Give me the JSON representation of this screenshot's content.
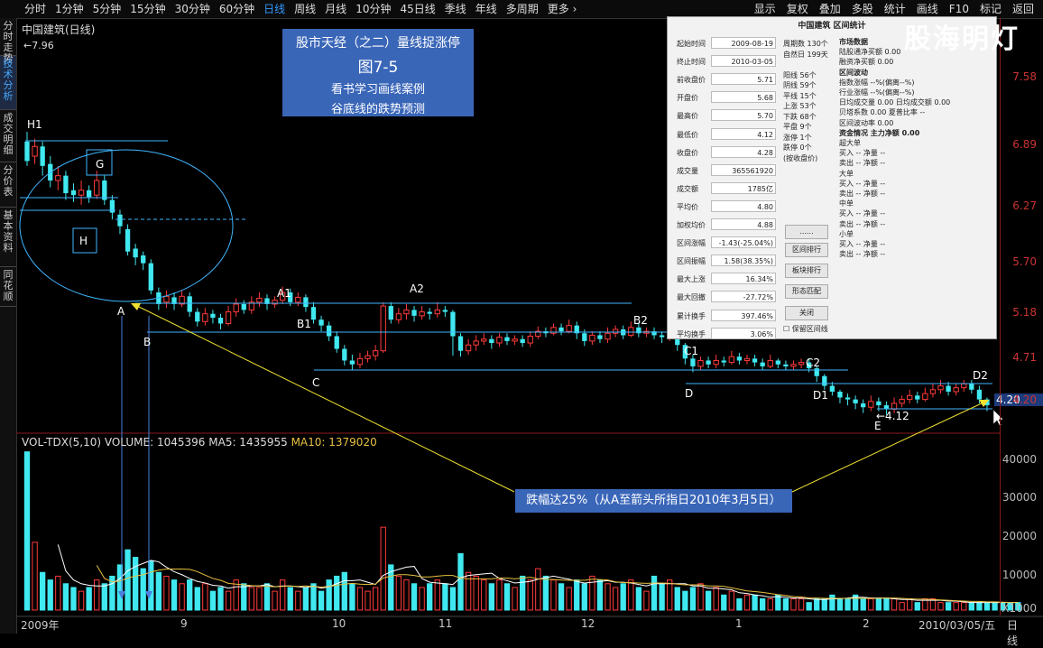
{
  "topbar": {
    "tabs": [
      "分时",
      "1分钟",
      "5分钟",
      "15分钟",
      "30分钟",
      "60分钟",
      "日线",
      "周线",
      "月线",
      "10分钟",
      "45日线",
      "季线",
      "年线",
      "多周期",
      "更多 ›"
    ],
    "active_tab": "日线",
    "right": [
      "显示",
      "复权",
      "叠加",
      "多股",
      "统计",
      "画线",
      "F10",
      "标记",
      "返回"
    ]
  },
  "sidebar": [
    "分时走势",
    "技术分析",
    "成交明细",
    "分价表",
    "基本资料",
    "同花顺"
  ],
  "stock": {
    "name": "中国建筑(日线)",
    "high_label": "7.96"
  },
  "price_axis": [
    "7.58",
    "6.89",
    "6.27",
    "5.70",
    "5.18",
    "4.71",
    "4.20"
  ],
  "current_price": "4.20",
  "vol_axis": [
    "40000",
    "30000",
    "20000",
    "10000",
    "X1000"
  ],
  "date_axis": [
    "2009年",
    "9",
    "10",
    "11",
    "12",
    "1",
    "2",
    "2010/03/05/五",
    "日线"
  ],
  "title_box": {
    "line1": "股市天经（之二）量线捉涨停",
    "line2": "图7-5",
    "line3": "看书学习画线案例",
    "line4": "谷底线的跌势预测"
  },
  "note": "跌幅达25%（从A至箭头所指日2010年3月5日）",
  "vol_legend": {
    "name": "VOL-TDX(5,10)",
    "volume": "VOLUME: 1045396",
    "ma5": "MA5: 1435955",
    "ma10": "MA10: 1379020"
  },
  "points": {
    "H1": "H1",
    "G": "G",
    "H": "H",
    "A": "A",
    "B": "B",
    "A1": "A1",
    "B1": "B1",
    "C": "C",
    "A2": "A2",
    "B2": "B2",
    "C1": "C1",
    "D": "D",
    "C2": "C2",
    "D1": "D1",
    "D2": "D2",
    "E": "E",
    "low": "←4.12"
  },
  "watermark": "股海明灯",
  "panel": {
    "title": "中国建筑 区间统计",
    "rows": [
      [
        "起始时间",
        "2009-08-19"
      ],
      [
        "终止时间",
        "2010-03-05"
      ],
      [
        "前收盘价",
        "5.71"
      ],
      [
        "开盘价",
        "5.68"
      ],
      [
        "最高价",
        "5.70"
      ],
      [
        "最低价",
        "4.12"
      ],
      [
        "收盘价",
        "4.28"
      ],
      [
        "成交量",
        "365561920"
      ],
      [
        "成交额",
        "1785亿"
      ],
      [
        "平均价",
        "4.80"
      ],
      [
        "加权均价",
        "4.88"
      ],
      [
        "区间涨幅",
        "-1.43(-25.04%)"
      ],
      [
        "区间振幅",
        "1.58(38.35%)"
      ],
      [
        "最大上涨",
        "16.34%"
      ],
      [
        "最大回撤",
        "-27.72%"
      ],
      [
        "累计换手",
        "397.46%"
      ],
      [
        "平均换手",
        "3.06%"
      ]
    ],
    "stats": [
      "周期数 130个",
      "自然日 199天",
      "",
      "阳线 56个",
      "阴线 59个",
      "平线 15个",
      "上涨 53个",
      "下跌 68个",
      "平盘 9个",
      "涨停 1个",
      "跌停 0个",
      "(按收盘价)"
    ],
    "buttons": [
      "......",
      "区间排行",
      "板块排行",
      "形态匹配",
      "关闭"
    ],
    "checkbox": "保留区间线",
    "market": [
      {
        "t": "市场数据",
        "h": true
      },
      {
        "t": "陆股通净买额 0.00"
      },
      {
        "t": "融资净买额 0.00"
      },
      {
        "t": "区间波动",
        "h": true
      },
      {
        "t": "指数涨幅 --%(偏离--%)"
      },
      {
        "t": "行业涨幅 --%(偏离--%)"
      },
      {
        "t": "日均成交量 0.00   日均成交额 0.00"
      },
      {
        "t": "贝塔系数 0.00    夏普比率 --"
      },
      {
        "t": "区间波动率 0.00"
      },
      {
        "t": "资金情况  主力净额 0.00",
        "h": true
      },
      {
        "t": "超大单"
      },
      {
        "t": "买入 --      净量 --"
      },
      {
        "t": "卖出 --      净额 --"
      },
      {
        "t": "大单"
      },
      {
        "t": "买入 --      净量 --"
      },
      {
        "t": "卖出 --      净额 --"
      },
      {
        "t": "中单"
      },
      {
        "t": "买入 --      净量 --"
      },
      {
        "t": "卖出 --      净额 --"
      },
      {
        "t": "小单"
      },
      {
        "t": "买入 --      净量 --"
      },
      {
        "t": "卖出 --      净额 --"
      }
    ]
  },
  "colors": {
    "up": "#ff3b3b",
    "down": "#40e8f0",
    "ma5": "#ffffff",
    "ma10": "#e8c040",
    "line": "#3fb6ff",
    "arrow": "#f0e030",
    "axis": "#8b1a1a"
  },
  "candles": [
    [
      6.95,
      6.75,
      7.05,
      6.7
    ],
    [
      6.8,
      6.9,
      6.98,
      6.72
    ],
    [
      6.9,
      6.7,
      6.95,
      6.6
    ],
    [
      6.72,
      6.55,
      6.8,
      6.48
    ],
    [
      6.55,
      6.6,
      6.7,
      6.45
    ],
    [
      6.6,
      6.42,
      6.65,
      6.35
    ],
    [
      6.45,
      6.4,
      6.52,
      6.33
    ],
    [
      6.4,
      6.45,
      6.55,
      6.3
    ],
    [
      6.45,
      6.38,
      6.5,
      6.32
    ],
    [
      6.4,
      6.55,
      6.65,
      6.36
    ],
    [
      6.55,
      6.35,
      6.6,
      6.3
    ],
    [
      6.35,
      6.22,
      6.4,
      6.15
    ],
    [
      6.2,
      6.08,
      6.25,
      6.0
    ],
    [
      6.05,
      5.82,
      6.1,
      5.78
    ],
    [
      5.85,
      5.76,
      5.9,
      5.68
    ],
    [
      5.78,
      5.7,
      5.82,
      5.63
    ],
    [
      5.7,
      5.42,
      5.74,
      5.38
    ],
    [
      5.4,
      5.28,
      5.45,
      5.22
    ],
    [
      5.3,
      5.36,
      5.42,
      5.24
    ],
    [
      5.35,
      5.28,
      5.4,
      5.22
    ],
    [
      5.28,
      5.36,
      5.42,
      5.25
    ],
    [
      5.36,
      5.2,
      5.4,
      5.15
    ],
    [
      5.2,
      5.1,
      5.24,
      5.05
    ],
    [
      5.1,
      5.18,
      5.24,
      5.06
    ],
    [
      5.18,
      5.14,
      5.22,
      5.08
    ],
    [
      5.14,
      5.08,
      5.18,
      5.02
    ],
    [
      5.08,
      5.2,
      5.26,
      5.06
    ],
    [
      5.2,
      5.28,
      5.34,
      5.15
    ],
    [
      5.28,
      5.22,
      5.32,
      5.18
    ],
    [
      5.22,
      5.3,
      5.36,
      5.18
    ],
    [
      5.3,
      5.34,
      5.4,
      5.25
    ],
    [
      5.34,
      5.28,
      5.38,
      5.22
    ],
    [
      5.28,
      5.32,
      5.36,
      5.24
    ],
    [
      5.32,
      5.4,
      5.46,
      5.28
    ],
    [
      5.4,
      5.3,
      5.44,
      5.26
    ],
    [
      5.3,
      5.35,
      5.4,
      5.26
    ],
    [
      5.35,
      5.25,
      5.38,
      5.2
    ],
    [
      5.25,
      5.12,
      5.3,
      5.08
    ],
    [
      5.12,
      5.06,
      5.16,
      5.0
    ],
    [
      5.06,
      4.95,
      5.1,
      4.9
    ],
    [
      4.95,
      4.82,
      5.0,
      4.78
    ],
    [
      4.82,
      4.7,
      4.86,
      4.65
    ],
    [
      4.7,
      4.66,
      4.76,
      4.6
    ],
    [
      4.66,
      4.72,
      4.78,
      4.62
    ],
    [
      4.72,
      4.75,
      4.8,
      4.68
    ],
    [
      4.75,
      4.8,
      4.86,
      4.7
    ],
    [
      4.8,
      5.26,
      5.3,
      4.78
    ],
    [
      5.26,
      5.12,
      5.3,
      5.08
    ],
    [
      5.12,
      5.18,
      5.24,
      5.08
    ],
    [
      5.18,
      5.22,
      5.28,
      5.12
    ],
    [
      5.22,
      5.16,
      5.26,
      5.1
    ],
    [
      5.16,
      5.2,
      5.26,
      5.12
    ],
    [
      5.2,
      5.18,
      5.24,
      5.12
    ],
    [
      5.18,
      5.22,
      5.3,
      5.14
    ],
    [
      5.22,
      5.2,
      5.26,
      5.15
    ],
    [
      5.2,
      4.95,
      5.22,
      4.75
    ],
    [
      4.95,
      4.8,
      4.98,
      4.74
    ],
    [
      4.8,
      4.86,
      4.92,
      4.76
    ],
    [
      4.86,
      4.9,
      4.96,
      4.8
    ],
    [
      4.9,
      4.92,
      4.98,
      4.86
    ],
    [
      4.92,
      4.88,
      4.96,
      4.82
    ],
    [
      4.88,
      4.94,
      4.98,
      4.84
    ],
    [
      4.94,
      4.9,
      4.98,
      4.86
    ],
    [
      4.9,
      4.92,
      4.96,
      4.86
    ],
    [
      4.92,
      4.88,
      4.96,
      4.84
    ],
    [
      4.88,
      4.95,
      5.0,
      4.84
    ],
    [
      4.95,
      5.0,
      5.05,
      4.92
    ],
    [
      5.0,
      4.98,
      5.04,
      4.94
    ],
    [
      4.98,
      5.04,
      5.08,
      4.96
    ],
    [
      5.04,
      5.0,
      5.08,
      4.96
    ],
    [
      5.0,
      5.06,
      5.12,
      4.98
    ],
    [
      5.06,
      4.98,
      5.1,
      4.92
    ],
    [
      4.98,
      4.9,
      5.02,
      4.85
    ],
    [
      4.9,
      4.96,
      5.0,
      4.86
    ],
    [
      4.96,
      4.92,
      5.0,
      4.88
    ],
    [
      4.92,
      4.98,
      5.04,
      4.88
    ],
    [
      4.98,
      5.02,
      5.06,
      4.94
    ],
    [
      5.02,
      4.96,
      5.06,
      4.92
    ],
    [
      4.96,
      5.04,
      5.1,
      4.94
    ],
    [
      5.04,
      4.98,
      5.08,
      4.94
    ],
    [
      4.98,
      5.0,
      5.04,
      4.94
    ],
    [
      5.0,
      4.96,
      5.04,
      4.92
    ],
    [
      4.96,
      4.94,
      5.0,
      4.88
    ],
    [
      4.94,
      4.98,
      5.02,
      4.9
    ],
    [
      4.98,
      4.86,
      5.0,
      4.8
    ],
    [
      4.86,
      4.72,
      4.88,
      4.66
    ],
    [
      4.72,
      4.64,
      4.76,
      4.58
    ],
    [
      4.64,
      4.7,
      4.74,
      4.6
    ],
    [
      4.7,
      4.66,
      4.74,
      4.62
    ],
    [
      4.66,
      4.7,
      4.76,
      4.62
    ],
    [
      4.7,
      4.68,
      4.74,
      4.64
    ],
    [
      4.68,
      4.74,
      4.8,
      4.66
    ],
    [
      4.74,
      4.7,
      4.78,
      4.66
    ],
    [
      4.7,
      4.72,
      4.76,
      4.66
    ],
    [
      4.72,
      4.68,
      4.76,
      4.64
    ],
    [
      4.68,
      4.64,
      4.72,
      4.6
    ],
    [
      4.64,
      4.7,
      4.76,
      4.62
    ],
    [
      4.7,
      4.66,
      4.72,
      4.62
    ],
    [
      4.66,
      4.64,
      4.7,
      4.6
    ],
    [
      4.64,
      4.66,
      4.7,
      4.6
    ],
    [
      4.66,
      4.68,
      4.72,
      4.62
    ],
    [
      4.68,
      4.62,
      4.72,
      4.58
    ],
    [
      4.62,
      4.54,
      4.64,
      4.48
    ],
    [
      4.54,
      4.44,
      4.56,
      4.4
    ],
    [
      4.44,
      4.38,
      4.48,
      4.34
    ],
    [
      4.38,
      4.32,
      4.4,
      4.26
    ],
    [
      4.32,
      4.3,
      4.36,
      4.24
    ],
    [
      4.3,
      4.26,
      4.34,
      4.2
    ],
    [
      4.26,
      4.22,
      4.3,
      4.16
    ],
    [
      4.22,
      4.28,
      4.34,
      4.18
    ],
    [
      4.28,
      4.24,
      4.32,
      4.18
    ],
    [
      4.24,
      4.2,
      4.28,
      4.14
    ],
    [
      4.2,
      4.26,
      4.32,
      4.16
    ],
    [
      4.26,
      4.3,
      4.34,
      4.22
    ],
    [
      4.3,
      4.34,
      4.4,
      4.26
    ],
    [
      4.34,
      4.3,
      4.38,
      4.26
    ],
    [
      4.3,
      4.36,
      4.42,
      4.28
    ],
    [
      4.36,
      4.4,
      4.46,
      4.32
    ],
    [
      4.4,
      4.44,
      4.5,
      4.36
    ],
    [
      4.44,
      4.38,
      4.48,
      4.34
    ],
    [
      4.38,
      4.42,
      4.46,
      4.34
    ],
    [
      4.42,
      4.46,
      4.5,
      4.38
    ],
    [
      4.46,
      4.4,
      4.5,
      4.36
    ],
    [
      4.4,
      4.3,
      4.44,
      4.26
    ],
    [
      4.3,
      4.24,
      4.32,
      4.18
    ]
  ],
  "volumes": [
    42,
    18,
    10,
    8,
    9,
    7,
    6,
    5,
    6,
    8,
    7,
    9,
    12,
    16,
    14,
    11,
    13,
    10,
    9,
    8,
    7,
    8,
    6,
    7,
    5,
    6,
    5,
    8,
    7,
    6,
    6,
    7,
    5,
    8,
    6,
    5,
    6,
    7,
    5,
    8,
    9,
    10,
    7,
    6,
    5,
    6,
    22,
    12,
    9,
    8,
    7,
    6,
    7,
    8,
    7,
    6,
    15,
    10,
    9,
    8,
    7,
    8,
    7,
    6,
    9,
    8,
    11,
    9,
    8,
    7,
    6,
    8,
    7,
    9,
    8,
    7,
    6,
    7,
    8,
    6,
    5,
    9,
    7,
    8,
    6,
    5,
    6,
    7,
    5,
    6,
    4,
    5,
    3,
    4,
    4,
    3,
    3,
    4,
    3,
    3,
    3,
    2,
    3,
    3,
    4,
    3,
    3,
    4,
    3,
    3,
    3,
    3,
    3,
    2,
    3,
    2,
    3,
    3,
    2,
    2,
    2,
    2,
    2,
    2,
    2,
    2,
    2,
    2,
    2
  ]
}
